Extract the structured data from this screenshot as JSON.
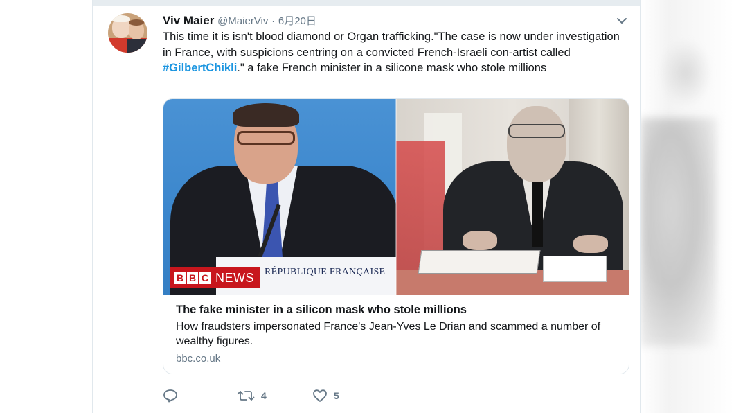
{
  "tweet": {
    "author_name": "Viv Maier",
    "handle": "@MaierViv",
    "separator": "·",
    "date": "6月20日",
    "text_before": "This time it is isn't blood diamond or Organ trafficking.\"The case is now under investigation in France, with suspicions centring on a convicted French-Israeli con-artist called ",
    "hashtag": "#GilbertChikli",
    "text_after": ".\" a fake French minister in a silicone mask who stole millions"
  },
  "link_card": {
    "media_left": {
      "podium_text": "RÉPUBLIQUE FRANÇAISE",
      "badge_letters": [
        "B",
        "B",
        "C"
      ],
      "badge_news": "NEWS"
    },
    "title": "The fake minister in a silicon mask who stole millions",
    "description": "How fraudsters impersonated France's Jean-Yves Le Drian and scammed a number of wealthy figures.",
    "domain": "bbc.co.uk"
  },
  "actions": {
    "reply_icon": "reply-icon",
    "retweet_icon": "retweet-icon",
    "retweet_count": "4",
    "like_icon": "heart-icon",
    "like_count": "5"
  },
  "colors": {
    "hashtag": "#1b95e0",
    "secondary_text": "#657786",
    "bbc_red": "#c8161d"
  }
}
